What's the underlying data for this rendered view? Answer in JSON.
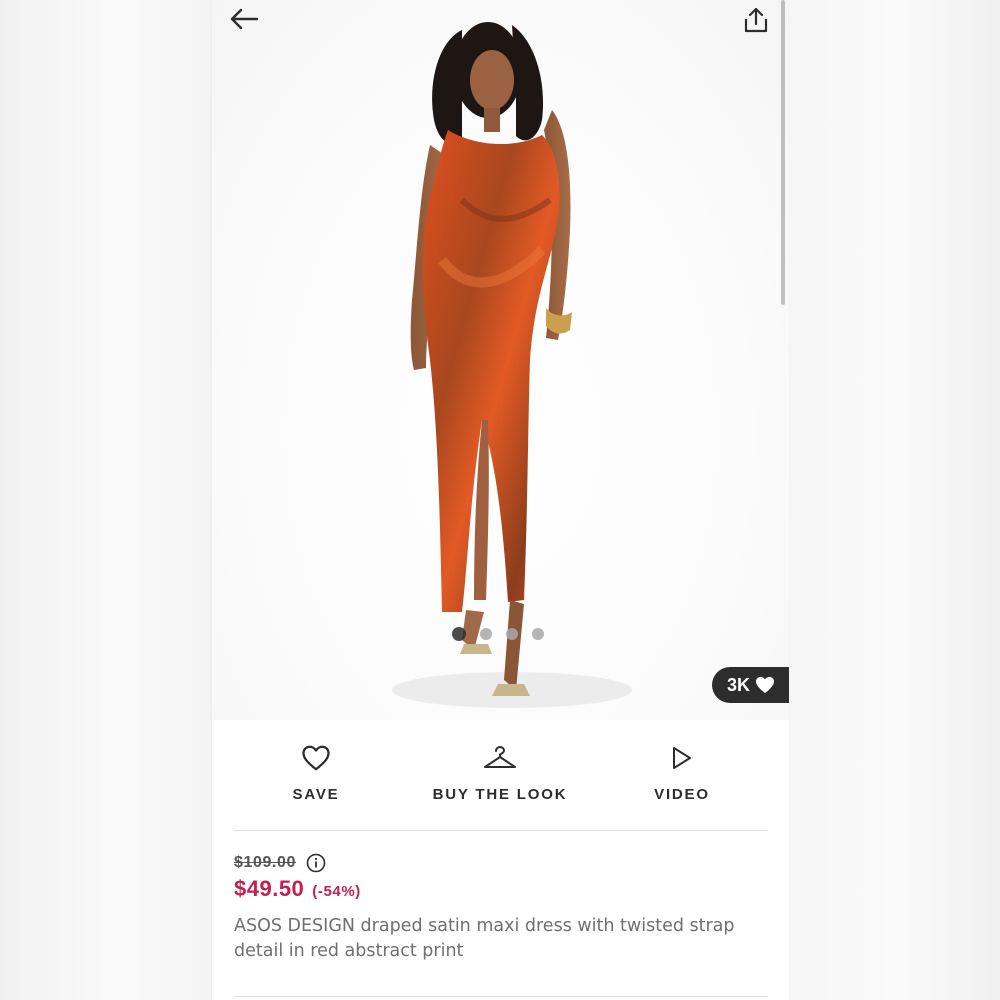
{
  "nav": {
    "back_icon": "arrow-left-icon",
    "share_icon": "share-icon"
  },
  "gallery": {
    "image_subject": "Model in orange abstract-print draped satin maxi dress",
    "image_count": 4,
    "active_index": 0,
    "likes_label": "3K",
    "likes_icon": "heart-filled-icon"
  },
  "actions": [
    {
      "label": "SAVE",
      "icon": "heart-outline-icon"
    },
    {
      "label": "BUY THE LOOK",
      "icon": "hanger-icon"
    },
    {
      "label": "VIDEO",
      "icon": "play-icon"
    }
  ],
  "product": {
    "was_price": "$109.00",
    "info_icon": "info-icon",
    "price": "$49.50",
    "discount": "(-54%)",
    "name": "ASOS DESIGN draped satin maxi dress with twisted strap detail in red abstract print"
  },
  "colors": {
    "sale": "#c41f4f",
    "text": "#2d2d2d",
    "muted": "#6f6f6f",
    "dress": "#d9461f"
  }
}
